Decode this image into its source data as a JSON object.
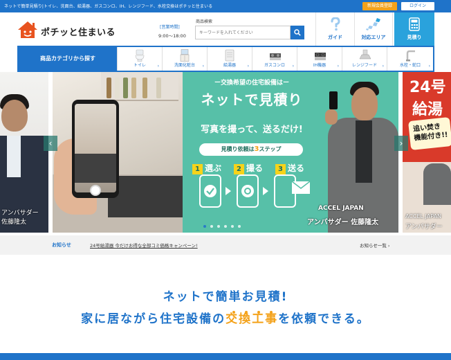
{
  "topbar": {
    "tagline": "ネットで簡単見積り|トイレ、洗面台、給湯器、ガスコンロ、IH、レンジフード、水栓交換はポチッと住まいる",
    "register_label": "新規会員登録",
    "login_label": "ログイン"
  },
  "header": {
    "logo_text": "ポチッと住まいる",
    "hours_label": "[営業時間]",
    "hours_value": "9:00～18:00",
    "search_label": "商品検索",
    "search_placeholder": "キーワードを入れてください",
    "nav": [
      {
        "label": "ガイド",
        "icon": "question-icon"
      },
      {
        "label": "対応エリア",
        "icon": "map-icon"
      },
      {
        "label": "見積り",
        "icon": "calculator-icon"
      }
    ]
  },
  "categories": {
    "title": "商品カテゴリから探す",
    "items": [
      {
        "label": "トイレ"
      },
      {
        "label": "洗面化粧台"
      },
      {
        "label": "給湯器"
      },
      {
        "label": "ガスコンロ"
      },
      {
        "label": "IH機器"
      },
      {
        "label": "レンジフード"
      },
      {
        "label": "水栓・蛇口"
      }
    ]
  },
  "hero": {
    "left_caption_1": "アンバサダー",
    "left_caption_2": "佐藤隆太",
    "small_top": "ー交換希望の住宅設備はー",
    "big_title": "ネットで見積り",
    "slogan": "写真を撮って、送るだけ!",
    "steps_pre": "見積り依頼は",
    "steps_num": "3",
    "steps_post": "ステップ",
    "step1_num": "1",
    "step1": "選ぶ",
    "step2_num": "2",
    "step2": "撮る",
    "step3_num": "3",
    "step3": "送る",
    "brand": "ACCEL JAPAN",
    "ambassador": "アンバサダー 佐藤隆太",
    "right_title_1": "24号",
    "right_title_2": "給湯",
    "right_badge": "追い焚き\n機能付き!!",
    "right_caption_1": "ACCEL JAPAN",
    "right_caption_2": "アンバサダー",
    "prev_arrow": "‹",
    "next_arrow": "›",
    "slide_count": 6,
    "active_slide": 1
  },
  "news": {
    "label": "お知らせ",
    "text": "24号給湯器 今だけお得な全部コミ価格キャンペーン!",
    "link": "お知らせ一覧 ›"
  },
  "headline": {
    "line1": "ネットで簡単お見積!",
    "line2_pre": "家に居ながら住宅設備の",
    "line2_highlight": "交換工事",
    "line2_post": "を依頼できる。"
  },
  "colors": {
    "brand_blue": "#1f73c9",
    "accent_orange": "#f4a21a",
    "mint": "#57c0a8",
    "quote_blue": "#2aa2dc"
  }
}
